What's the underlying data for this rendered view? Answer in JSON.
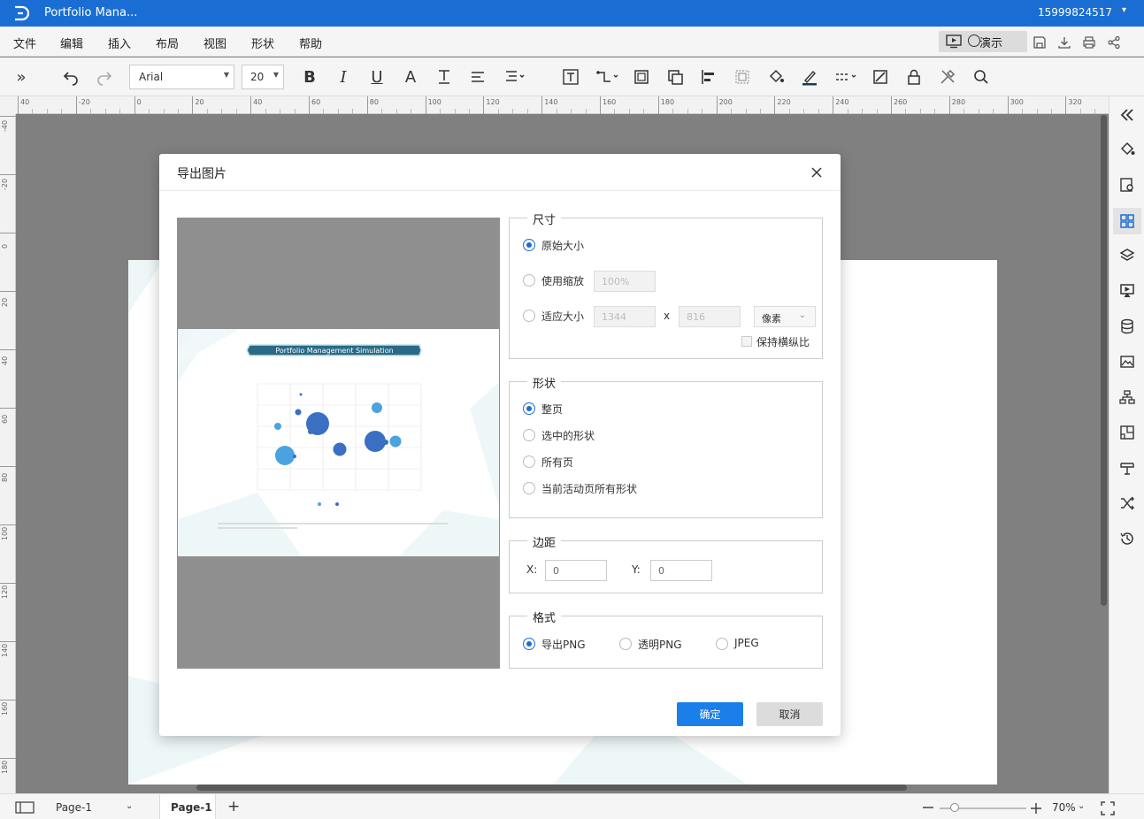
{
  "titlebar": {
    "doc_title": "Portfolio Mana...",
    "user": "15999824517",
    "caret": "▾"
  },
  "menu": {
    "items": [
      "文件",
      "编辑",
      "插入",
      "布局",
      "视图",
      "形状",
      "帮助"
    ],
    "present": "演示"
  },
  "toolbar": {
    "font": "Arial",
    "size": "20"
  },
  "ruler": {
    "h_ticks": [
      "40",
      "-20",
      "0",
      "20",
      "40",
      "60",
      "80",
      "100",
      "120",
      "140",
      "160",
      "180",
      "200",
      "220",
      "240",
      "260",
      "280",
      "300",
      "320"
    ],
    "v_ticks": [
      "-40",
      "-20",
      "0",
      "20",
      "40",
      "60",
      "80",
      "100",
      "120",
      "140",
      "160",
      "180"
    ]
  },
  "dialog": {
    "title": "导出图片",
    "size": {
      "legend": "尺寸",
      "original": "原始大小",
      "scale": "使用缩放",
      "scale_value": "100%",
      "fit": "适应大小",
      "width": "1344",
      "height": "816",
      "x_sep": "x",
      "unit": "像素",
      "keep_ratio": "保持横纵比"
    },
    "shape": {
      "legend": "形状",
      "options": [
        "整页",
        "选中的形状",
        "所有页",
        "当前活动页所有形状"
      ]
    },
    "margin": {
      "legend": "边距",
      "x_label": "X:",
      "x_value": "0",
      "y_label": "Y:",
      "y_value": "0"
    },
    "format": {
      "legend": "格式",
      "options": [
        "导出PNG",
        "透明PNG",
        "JPEG"
      ]
    },
    "ok": "确定",
    "cancel": "取消"
  },
  "preview": {
    "banner": "Portfolio Management Simulation"
  },
  "status": {
    "page_select": "Page-1",
    "page_tab": "Page-1",
    "add": "+",
    "zoom": "70%"
  },
  "colors": {
    "accent": "#1a6ed3",
    "ok_button": "#1a7fe8",
    "banner": "#2a6a86",
    "bubble_light": "#4aa3e0",
    "bubble_dark": "#3a6fc4"
  }
}
